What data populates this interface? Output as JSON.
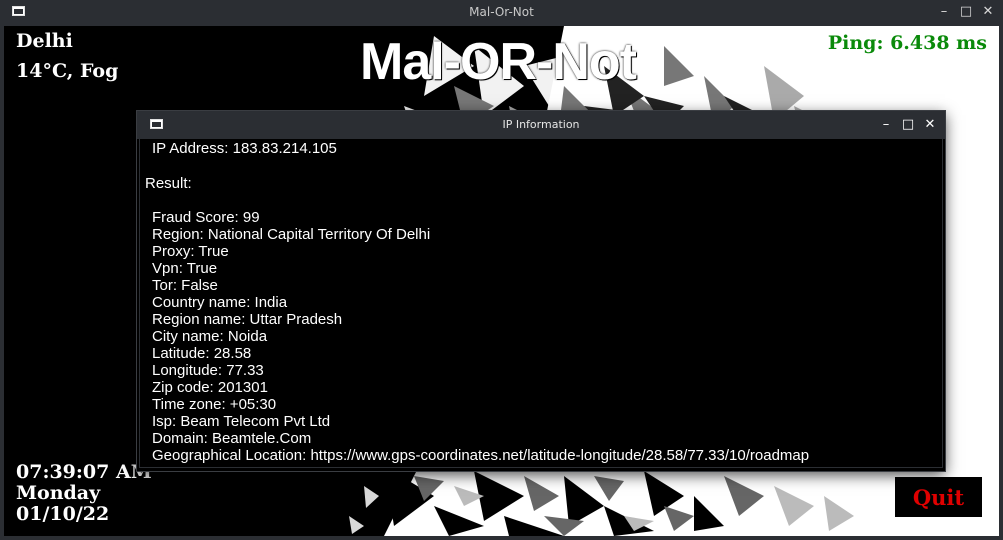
{
  "window": {
    "title": "Mal-Or-Not",
    "icon": "window-icon"
  },
  "app": {
    "title": "Mal-OR-Not",
    "city": "Delhi",
    "weather": "14°C, Fog",
    "ping": "Ping: 6.438 ms",
    "time": "07:39:07 AM",
    "day": "Monday",
    "date": "01/10/22",
    "quit_label": "Quit"
  },
  "dialog": {
    "title": "IP Information",
    "ip_line": "IP Address: 183.83.214.105",
    "result_label": "Result:",
    "fields": [
      "Fraud Score: 99",
      "Region: National Capital Territory Of Delhi",
      "Proxy: True",
      "Vpn: True",
      "Tor: False",
      "Country name: India",
      "Region name: Uttar Pradesh",
      "City name: Noida",
      "Latitude: 28.58",
      "Longitude: 77.33",
      "Zip code: 201301",
      "Time zone: +05:30",
      "Isp: Beam Telecom Pvt Ltd",
      "Domain: Beamtele.Com",
      "Geographical Location: https://www.gps-coordinates.net/latitude-longitude/28.58/77.33/10/roadmap"
    ]
  },
  "colors": {
    "ping": "#0a8a0a",
    "quit": "#e00000",
    "titlebar": "#2b2e33"
  }
}
